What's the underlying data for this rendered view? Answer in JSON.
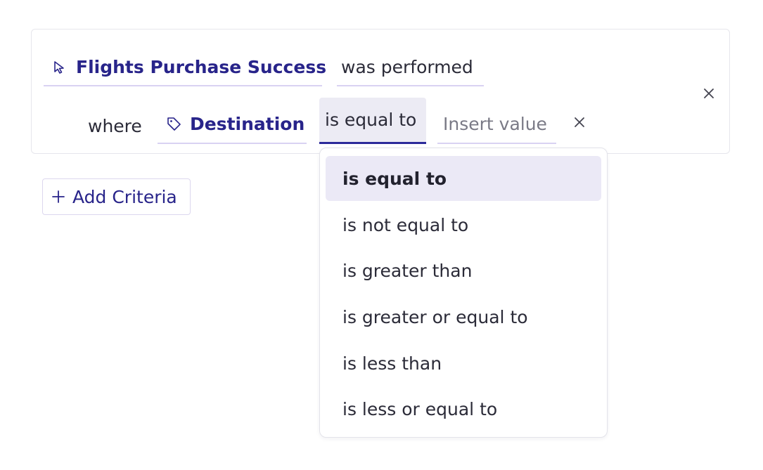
{
  "filter": {
    "event_name": "Flights Purchase Success",
    "event_condition": "was performed",
    "where_label": "where",
    "property_name": "Destination",
    "operator": "is equal to",
    "value_placeholder": "Insert value"
  },
  "add_criteria_label": "Add Criteria",
  "operator_menu": {
    "selected_index": 0,
    "options": [
      "is equal to",
      "is not equal to",
      "is greater than",
      "is greater or equal to",
      "is less than",
      "is less or equal to"
    ]
  },
  "icons": {
    "event": "cursor-arrow-icon",
    "property": "tag-icon",
    "add": "plus-icon",
    "remove": "close-icon"
  },
  "colors": {
    "accent": "#28248a",
    "accent_underline": "#2c2a9a",
    "light_underline": "#d9d2f2",
    "selected_bg": "#ebe9f6",
    "operator_bg": "#ecebf4",
    "border": "#e6e6ec",
    "text": "#2b2b38",
    "placeholder": "#7a7a86"
  }
}
